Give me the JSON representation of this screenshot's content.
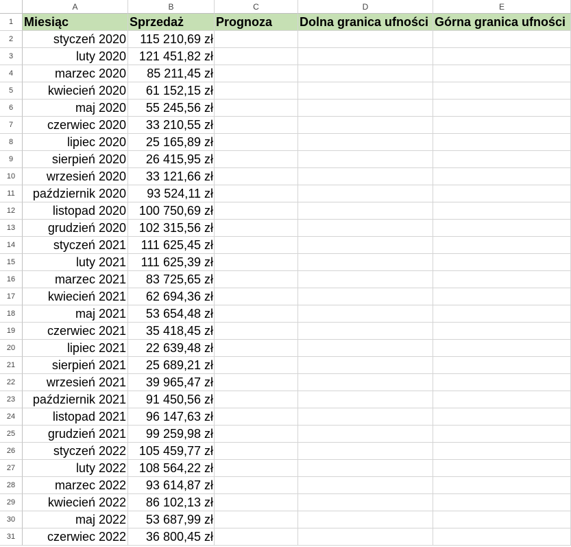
{
  "sheet": {
    "column_headers": [
      "A",
      "B",
      "C",
      "D",
      "E"
    ],
    "header_fill_color": "#c6e0b4",
    "header_row": {
      "row_number": "1",
      "cells": [
        "Miesiąc",
        "Sprzedaż",
        "Prognoza",
        "Dolna granica ufności",
        "Górna granica ufności"
      ]
    },
    "rows": [
      {
        "n": "2",
        "month": "styczeń 2020",
        "sales": "115 210,69 zł"
      },
      {
        "n": "3",
        "month": "luty 2020",
        "sales": "121 451,82 zł"
      },
      {
        "n": "4",
        "month": "marzec 2020",
        "sales": "85 211,45 zł"
      },
      {
        "n": "5",
        "month": "kwiecień 2020",
        "sales": "61 152,15 zł"
      },
      {
        "n": "6",
        "month": "maj 2020",
        "sales": "55 245,56 zł"
      },
      {
        "n": "7",
        "month": "czerwiec 2020",
        "sales": "33 210,55 zł"
      },
      {
        "n": "8",
        "month": "lipiec 2020",
        "sales": "25 165,89 zł"
      },
      {
        "n": "9",
        "month": "sierpień 2020",
        "sales": "26 415,95 zł"
      },
      {
        "n": "10",
        "month": "wrzesień 2020",
        "sales": "33 121,66 zł"
      },
      {
        "n": "11",
        "month": "październik 2020",
        "sales": "93 524,11 zł"
      },
      {
        "n": "12",
        "month": "listopad 2020",
        "sales": "100 750,69 zł"
      },
      {
        "n": "13",
        "month": "grudzień 2020",
        "sales": "102 315,56 zł"
      },
      {
        "n": "14",
        "month": "styczeń 2021",
        "sales": "111 625,45 zł"
      },
      {
        "n": "15",
        "month": "luty 2021",
        "sales": "111 625,39 zł"
      },
      {
        "n": "16",
        "month": "marzec 2021",
        "sales": "83 725,65 zł"
      },
      {
        "n": "17",
        "month": "kwiecień 2021",
        "sales": "62 694,36 zł"
      },
      {
        "n": "18",
        "month": "maj 2021",
        "sales": "53 654,48 zł"
      },
      {
        "n": "19",
        "month": "czerwiec 2021",
        "sales": "35 418,45 zł"
      },
      {
        "n": "20",
        "month": "lipiec 2021",
        "sales": "22 639,48 zł"
      },
      {
        "n": "21",
        "month": "sierpień 2021",
        "sales": "25 689,21 zł"
      },
      {
        "n": "22",
        "month": "wrzesień 2021",
        "sales": "39 965,47 zł"
      },
      {
        "n": "23",
        "month": "październik 2021",
        "sales": "91 450,56 zł"
      },
      {
        "n": "24",
        "month": "listopad 2021",
        "sales": "96 147,63 zł"
      },
      {
        "n": "25",
        "month": "grudzień 2021",
        "sales": "99 259,98 zł"
      },
      {
        "n": "26",
        "month": "styczeń 2022",
        "sales": "105 459,77 zł"
      },
      {
        "n": "27",
        "month": "luty 2022",
        "sales": "108 564,22 zł"
      },
      {
        "n": "28",
        "month": "marzec 2022",
        "sales": "93 614,87 zł"
      },
      {
        "n": "29",
        "month": "kwiecień 2022",
        "sales": "86 102,13 zł"
      },
      {
        "n": "30",
        "month": "maj 2022",
        "sales": "53 687,99 zł"
      },
      {
        "n": "31",
        "month": "czerwiec 2022",
        "sales": "36 800,45 zł"
      }
    ]
  }
}
